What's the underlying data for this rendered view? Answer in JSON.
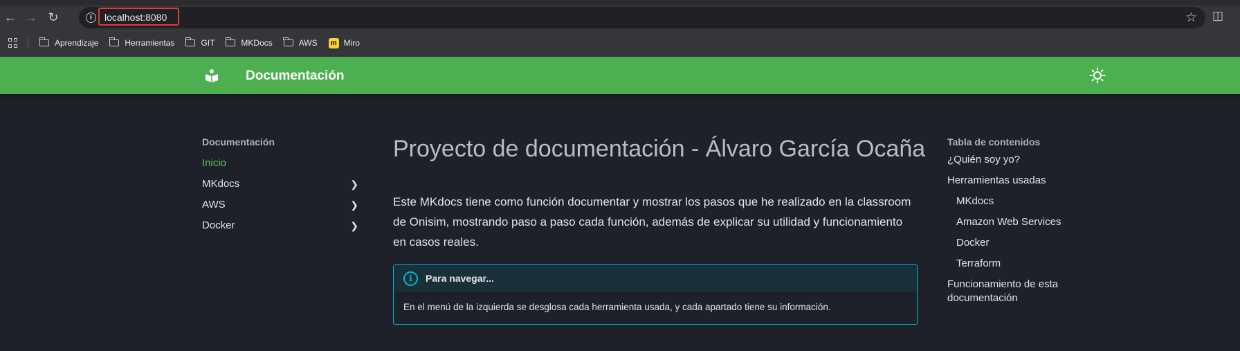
{
  "browser": {
    "url": "localhost:8080",
    "bookmarks": [
      {
        "label": "Aprendizaje",
        "icon": "folder-icon"
      },
      {
        "label": "Herramientas",
        "icon": "folder-icon"
      },
      {
        "label": "GIT",
        "icon": "folder-icon"
      },
      {
        "label": "MKDocs",
        "icon": "folder-icon"
      },
      {
        "label": "AWS",
        "icon": "folder-icon"
      },
      {
        "label": "Miro",
        "icon": "miro-icon"
      }
    ]
  },
  "header": {
    "title": "Documentación",
    "color": "#4caf50"
  },
  "nav": {
    "heading": "Documentación",
    "items": [
      {
        "label": "Inicio",
        "active": true
      },
      {
        "label": "MKdocs",
        "expandable": true
      },
      {
        "label": "AWS",
        "expandable": true
      },
      {
        "label": "Docker",
        "expandable": true
      }
    ]
  },
  "main": {
    "title": "Proyecto de documentación - Álvaro García Ocaña",
    "intro": "Este MKdocs tiene como función documentar y mostrar los pasos que he realizado en la classroom de Onisim, mostrando paso a paso cada función, además de explicar su utilidad y funcionamiento en casos reales.",
    "admonition": {
      "title": "Para navegar...",
      "body": "En el menú de la izquierda se desglosa cada herramienta usada, y cada apartado tiene su información.",
      "color": "#00b8d4"
    }
  },
  "toc": {
    "heading": "Tabla de contenidos",
    "items": [
      {
        "label": "¿Quién soy yo?"
      },
      {
        "label": "Herramientas usadas"
      },
      {
        "label": "MKdocs"
      },
      {
        "label": "Amazon Web Services"
      },
      {
        "label": "Docker"
      },
      {
        "label": "Terraform"
      },
      {
        "label": "Funcionamiento de esta documentación"
      }
    ]
  }
}
